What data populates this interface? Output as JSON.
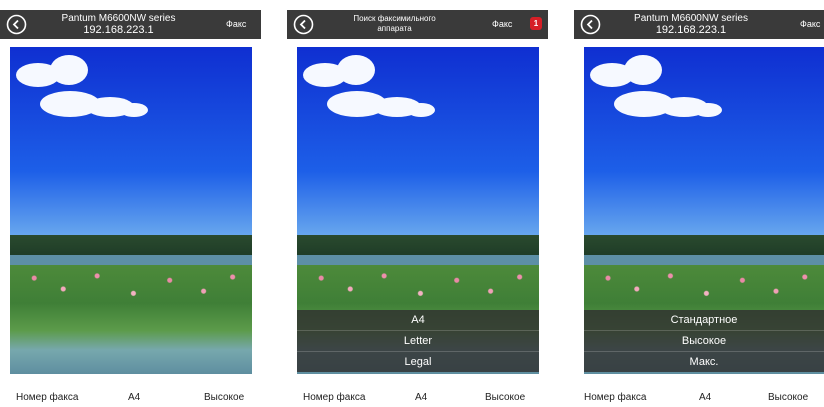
{
  "colors": {
    "header_bg": "#3a3a3a",
    "badge": "#d61f26",
    "sheet_bg": "#303030"
  },
  "panels": [
    {
      "header": {
        "title_line1": "Pantum M6600NW series",
        "title_line2": "192.168.223.1",
        "fax_label": "Факс"
      },
      "bottom": {
        "fax_number": "Номер факса",
        "paper_size": "A4",
        "quality": "Высокое"
      }
    },
    {
      "header": {
        "title_line1": "Поиск факсимильного",
        "title_line2": "аппарата",
        "fax_label": "Факс",
        "badge": "1"
      },
      "sheet": {
        "options": [
          "A4",
          "Letter",
          "Legal"
        ]
      },
      "bottom": {
        "fax_number": "Номер факса",
        "paper_size": "A4",
        "quality": "Высокое"
      }
    },
    {
      "header": {
        "title_line1": "Pantum M6600NW series",
        "title_line2": "192.168.223.1",
        "fax_label": "Факс"
      },
      "sheet": {
        "options": [
          "Стандартное",
          "Высокое",
          "Макс."
        ]
      },
      "bottom": {
        "fax_number": "Номер факса",
        "paper_size": "A4",
        "quality": "Высокое"
      }
    }
  ]
}
